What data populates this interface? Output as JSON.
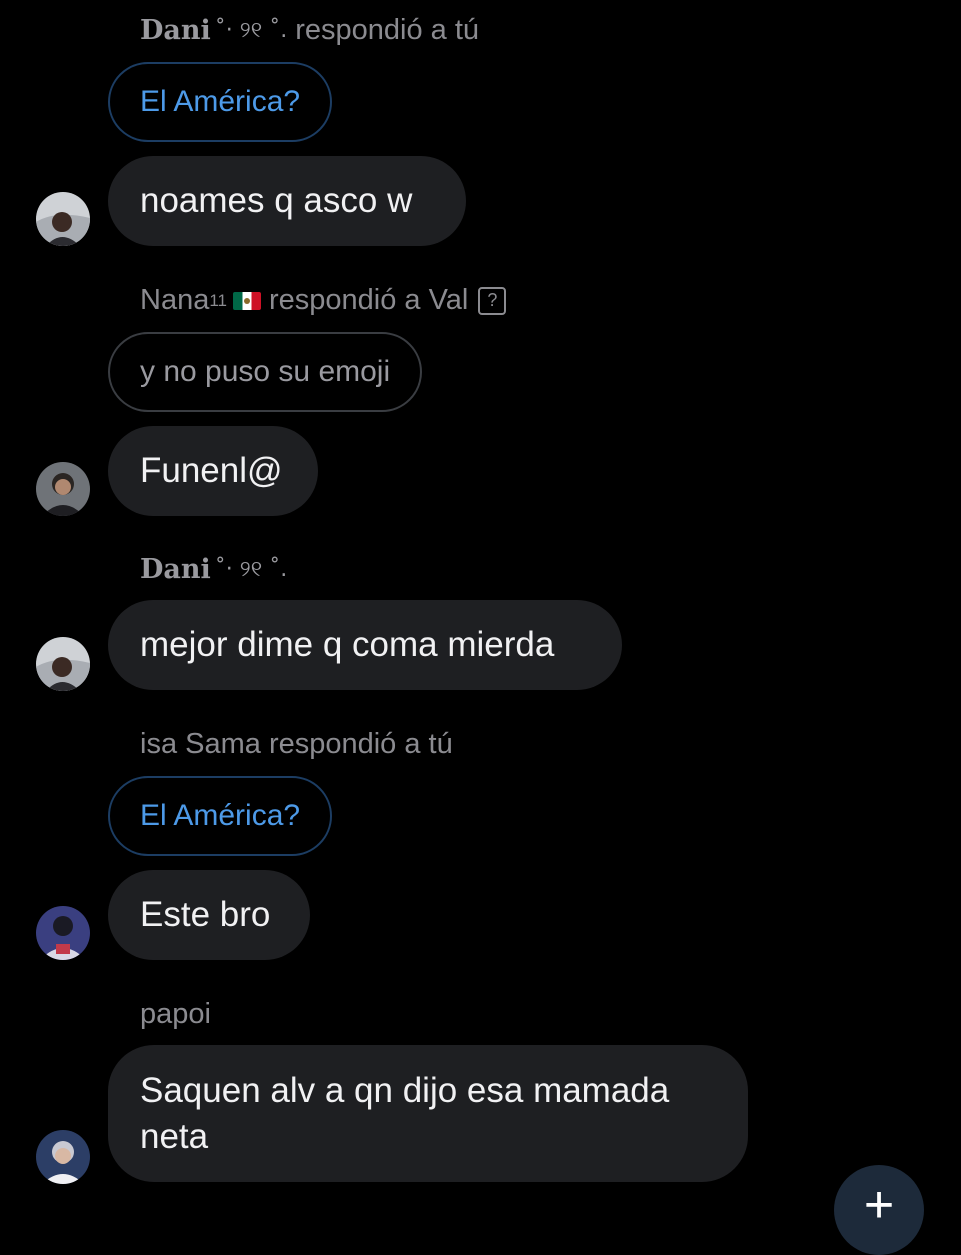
{
  "messages": [
    {
      "sender": "Dani",
      "sender_deco": "˚· ୨୧ ˚.",
      "reply_text": "respondió a tú",
      "quoted": "El América?",
      "text": "noames q asco w",
      "avatar": "avatar-person-1"
    },
    {
      "sender": "Nana",
      "sender_sup": "11",
      "flag": "mexico-flag",
      "reply_text": "respondió a Val",
      "badge": "?",
      "quoted": "y no puso su emoji",
      "text": "Funenl@",
      "avatar": "avatar-person-2"
    },
    {
      "sender": "Dani",
      "sender_deco": "˚· ୨୧ ˚.",
      "text": "mejor dime q coma mierda",
      "avatar": "avatar-person-1"
    },
    {
      "sender_line": "isa Sama respondió a tú",
      "quoted": "El América?",
      "text": "Este bro",
      "avatar": "avatar-person-3"
    },
    {
      "sender_line": "papoi",
      "text": "Saquen alv a qn dijo esa mamada neta",
      "avatar": "avatar-person-4"
    }
  ],
  "fab": {
    "label": "+",
    "icon": "plus-icon"
  },
  "colors": {
    "background": "#000000",
    "bubble": "#1e1f22",
    "link_blue": "#4d9ae8",
    "meta_gray": "#8b8b90"
  }
}
